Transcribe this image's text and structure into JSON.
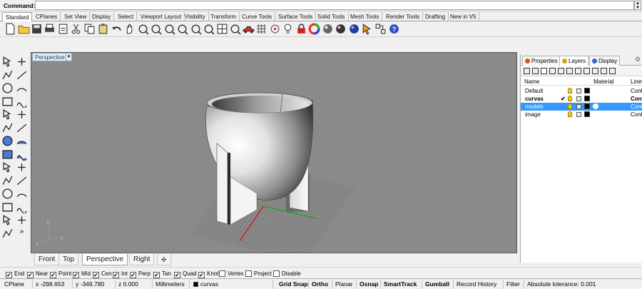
{
  "command": {
    "label": "Command:",
    "value": ""
  },
  "tabs": [
    "Standard",
    "CPlanes",
    "Set View",
    "Display",
    "Select",
    "Viewport Layout",
    "Visibility",
    "Transform",
    "Curve Tools",
    "Surface Tools",
    "Solid Tools",
    "Mesh Tools",
    "Render Tools",
    "Drafting",
    "New in V5"
  ],
  "active_tab": "Standard",
  "toolbar_icons": [
    "new-icon",
    "open-icon",
    "save-icon",
    "print-icon",
    "import-icon",
    "cut-icon",
    "copy-icon",
    "paste-icon",
    "undo-icon",
    "pan-icon",
    "rotate-view-icon",
    "zoom-icon",
    "zoom-window-icon",
    "zoom-extents-icon",
    "zoom-selected-icon",
    "undo-view-icon",
    "four-views-icon",
    "set-cplane-icon",
    "car-icon",
    "grid-icon",
    "points-icon",
    "light-icon",
    "lock-icon",
    "color-wheel-icon",
    "render-sphere-icon",
    "shade-sphere-icon",
    "blue-sphere-icon",
    "arrow-select-icon",
    "group-icon",
    "help-icon"
  ],
  "viewport": {
    "label": "Perspective",
    "axis_x": "x",
    "axis_y": "y",
    "axis_z": "z"
  },
  "view_tabs": [
    "Front",
    "Top",
    "Perspective",
    "Right"
  ],
  "active_view": "Perspective",
  "view_tab_add": "✣",
  "panel": {
    "tabs": [
      "Properties",
      "Layers",
      "Display"
    ],
    "active": "Layers",
    "columns": {
      "name": "Name",
      "material": "Material",
      "linetype": "Linet"
    },
    "layers": [
      {
        "name": "Default",
        "current": false,
        "selected": false,
        "linetype": "Conti"
      },
      {
        "name": "curvas",
        "current": true,
        "selected": false,
        "linetype": "Cont"
      },
      {
        "name": "models",
        "current": false,
        "selected": true,
        "linetype": "Conti"
      },
      {
        "name": "image",
        "current": false,
        "selected": false,
        "linetype": "Conti"
      }
    ]
  },
  "osnaps": [
    {
      "label": "End",
      "checked": true
    },
    {
      "label": "Near",
      "checked": true
    },
    {
      "label": "Point",
      "checked": true
    },
    {
      "label": "Mid",
      "checked": true
    },
    {
      "label": "Cen",
      "checked": true
    },
    {
      "label": "Int",
      "checked": true
    },
    {
      "label": "Perp",
      "checked": true
    },
    {
      "label": "Tan",
      "checked": true
    },
    {
      "label": "Quad",
      "checked": true
    },
    {
      "label": "Knot",
      "checked": true
    },
    {
      "label": "Vertex",
      "checked": false
    },
    {
      "label": "Project",
      "checked": false
    },
    {
      "label": "Disable",
      "checked": false
    }
  ],
  "status": {
    "cplane": "CPlane",
    "x": "x -298.653",
    "y": "y -349.780",
    "z": "z 0.000",
    "units": "Millimeters",
    "layer": "curvas",
    "grid_snap": "Grid Snap",
    "ortho": "Ortho",
    "planar": "Planar",
    "osnap": "Osnap",
    "smarttrack": "SmartTrack",
    "gumball": "Gumball",
    "record_history": "Record History",
    "filter": "Filter",
    "tolerance": "Absolute tolerance: 0.001"
  },
  "colors": {
    "selection": "#3399ff",
    "viewport_bg": "#8a8a8a",
    "grid": "#7a7a7a",
    "x_axis": "#c81e1e",
    "y_axis": "#1ea01e"
  }
}
